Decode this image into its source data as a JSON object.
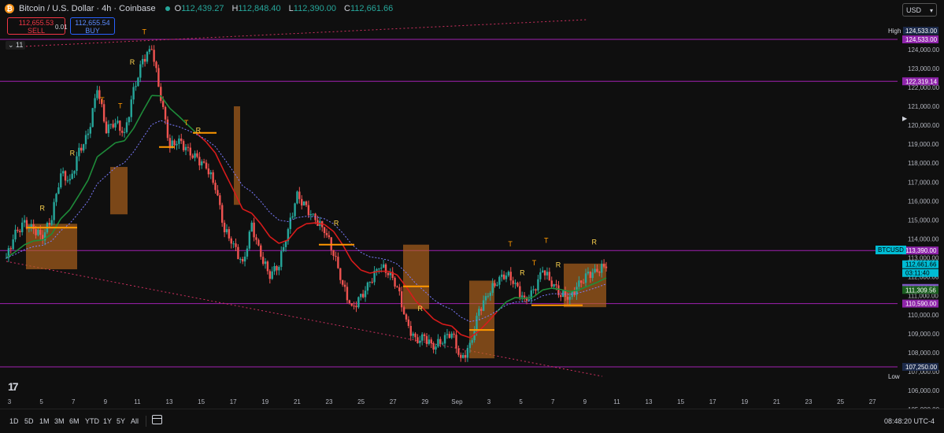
{
  "header": {
    "title": "Bitcoin / U.S. Dollar · 4h · Coinbase",
    "ohlc": [
      {
        "label": "O",
        "value": "112,439.27"
      },
      {
        "label": "H",
        "value": "112,848.40"
      },
      {
        "label": "L",
        "value": "112,390.00"
      },
      {
        "label": "C",
        "value": "112,661.66"
      }
    ],
    "sell_price": "112,655.53",
    "sell_label": "SELL",
    "buy_price": "112,655.54",
    "buy_label": "BUY",
    "spread": "0.01",
    "indicators_count": "11",
    "currency": "USD"
  },
  "price_axis": {
    "ticks": [
      {
        "value": 124000,
        "label": "124,000.00"
      },
      {
        "value": 123000,
        "label": "123,000.00"
      },
      {
        "value": 122000,
        "label": "122,000.00"
      },
      {
        "value": 121000,
        "label": "121,000.00"
      },
      {
        "value": 120000,
        "label": "120,000.00"
      },
      {
        "value": 119000,
        "label": "119,000.00"
      },
      {
        "value": 118000,
        "label": "118,000.00"
      },
      {
        "value": 117000,
        "label": "117,000.00"
      },
      {
        "value": 116000,
        "label": "116,000.00"
      },
      {
        "value": 115000,
        "label": "115,000.00"
      },
      {
        "value": 114000,
        "label": "114,000.00"
      },
      {
        "value": 113000,
        "label": "113,000.00"
      },
      {
        "value": 112000,
        "label": "112,000.00"
      },
      {
        "value": 111000,
        "label": "111,000.00"
      },
      {
        "value": 110000,
        "label": "110,000.00"
      },
      {
        "value": 109000,
        "label": "109,000.00"
      },
      {
        "value": 108000,
        "label": "108,000.00"
      },
      {
        "value": 107000,
        "label": "107,000.00"
      },
      {
        "value": 106000,
        "label": "106,000.00"
      },
      {
        "value": 105000,
        "label": "105,000.00"
      }
    ],
    "labels": [
      {
        "value": 124533,
        "label": "124,533.00",
        "style": "dark"
      },
      {
        "value": 124533,
        "label": "124,533.00",
        "style": "purple"
      },
      {
        "value": 122319.14,
        "label": "122,319.14",
        "style": "purple"
      },
      {
        "value": 113390,
        "label": "113,390.00",
        "style": "purple"
      },
      {
        "value": 112661.66,
        "label": "112,661.66",
        "style": "cyan"
      },
      {
        "value": 112661.66,
        "label": "03:11:40",
        "style": "cyan"
      },
      {
        "value": 111414.35,
        "label": "111,414.35",
        "style": "lilac"
      },
      {
        "value": 111309.56,
        "label": "111,309.56",
        "style": "green"
      },
      {
        "value": 110590,
        "label": "110,590.00",
        "style": "purple"
      },
      {
        "value": 107250,
        "label": "107,250.00",
        "style": "purple"
      },
      {
        "value": 107250,
        "label": "107,250.00",
        "style": "dark"
      }
    ],
    "high_tag": "High",
    "low_tag": "Low",
    "symbol_tag": "BTCUSD"
  },
  "time_axis": [
    "3",
    "5",
    "7",
    "9",
    "11",
    "13",
    "15",
    "17",
    "19",
    "21",
    "23",
    "25",
    "27",
    "29",
    "Sep",
    "3",
    "5",
    "7",
    "9",
    "11",
    "13",
    "15",
    "17",
    "19",
    "21",
    "23",
    "25",
    "27"
  ],
  "timeframes": [
    "1D",
    "5D",
    "1M",
    "3M",
    "6M",
    "YTD",
    "1Y",
    "5Y",
    "All"
  ],
  "clock": "08:48:20 UTC-4",
  "chart_data": {
    "type": "candlestick",
    "symbol": "BTCUSD",
    "interval": "4h",
    "x_labels": [
      "3",
      "5",
      "7",
      "9",
      "11",
      "13",
      "15",
      "17",
      "19",
      "21",
      "23",
      "25",
      "27",
      "29",
      "Sep",
      "3",
      "5",
      "7",
      "9"
    ],
    "ylim": [
      104600,
      125300
    ],
    "high": 124533,
    "low": 107250,
    "levels": [
      124533,
      122319.14,
      113390,
      110590,
      107250
    ],
    "close_path": [
      113000,
      114300,
      114800,
      114500,
      114100,
      115200,
      117500,
      117000,
      118600,
      119500,
      122000,
      119800,
      120200,
      119500,
      121800,
      123400,
      124100,
      121500,
      118900,
      119200,
      118600,
      118200,
      117800,
      116800,
      114500,
      113700,
      112600,
      114700,
      113100,
      112100,
      112700,
      114500,
      116300,
      115600,
      115000,
      114500,
      113300,
      111600,
      110300,
      110900,
      111700,
      112600,
      112300,
      111500,
      109600,
      108600,
      108800,
      108300,
      108700,
      109100,
      107600,
      108300,
      110200,
      111100,
      111800,
      112200,
      111600,
      110700,
      111200,
      112400,
      111700,
      111100,
      110900,
      111600,
      112100,
      112300,
      112661.66
    ],
    "markers": [
      {
        "t": 0.06,
        "text": "R"
      },
      {
        "t": 0.11,
        "text": "R"
      },
      {
        "t": 0.16,
        "text": "T"
      },
      {
        "t": 0.19,
        "text": "T"
      },
      {
        "t": 0.21,
        "text": "R"
      },
      {
        "t": 0.23,
        "text": "T"
      },
      {
        "t": 0.3,
        "text": "T"
      },
      {
        "t": 0.32,
        "text": "R"
      },
      {
        "t": 0.55,
        "text": "R"
      },
      {
        "t": 0.69,
        "text": "R"
      },
      {
        "t": 0.84,
        "text": "T"
      },
      {
        "t": 0.86,
        "text": "R"
      },
      {
        "t": 0.88,
        "text": "T"
      },
      {
        "t": 0.9,
        "text": "T"
      },
      {
        "t": 0.92,
        "text": "R"
      },
      {
        "t": 0.98,
        "text": "R"
      }
    ]
  }
}
